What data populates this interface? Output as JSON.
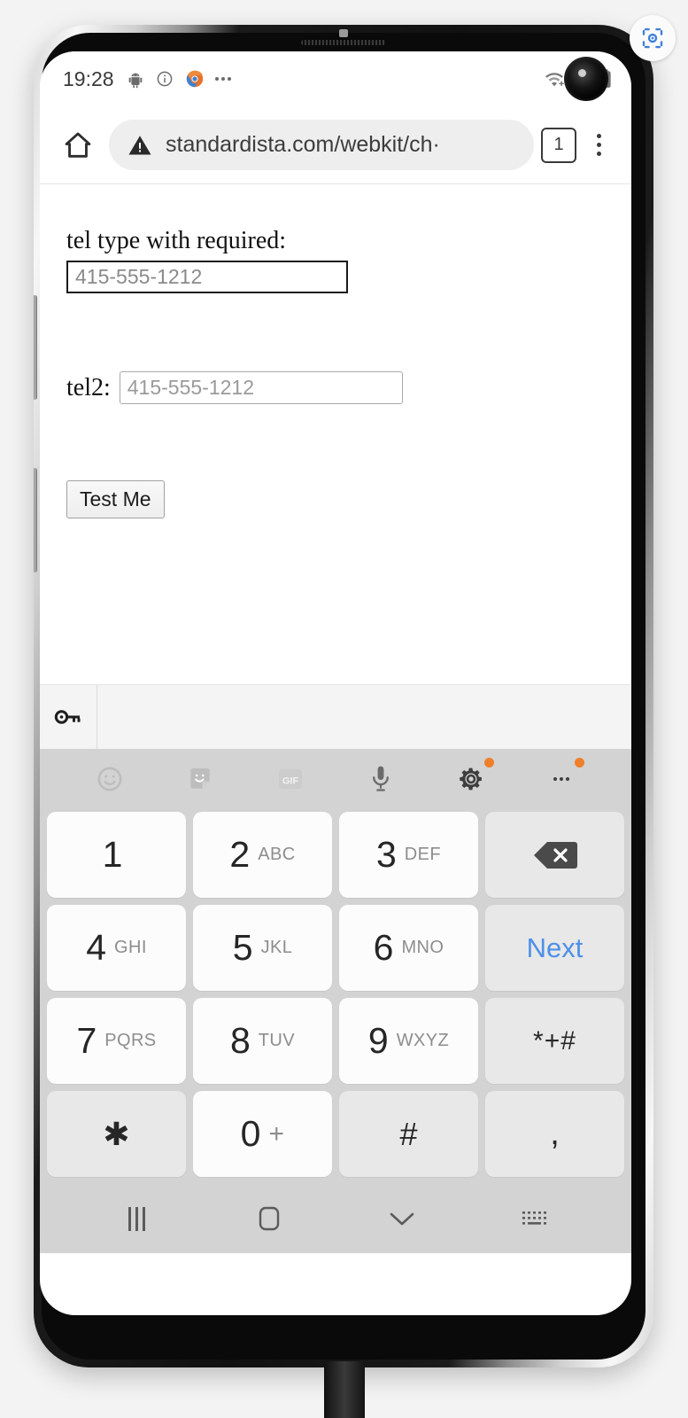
{
  "capture": {
    "icon": "screenshot-scan-icon",
    "accent": "#3f7fdb"
  },
  "statusbar": {
    "time": "19:28",
    "left_icons": [
      "android-robot-icon",
      "info-circle-icon",
      "chrome-icon",
      "more-notifications-icon"
    ],
    "right_icons": [
      "wifi-plus-icon",
      "cellular-signal-icon",
      "battery-icon"
    ]
  },
  "browser": {
    "home_icon": "home-icon",
    "security_icon": "not-secure-warning-icon",
    "url": "standardista.com/webkit/ch·",
    "tab_count": "1",
    "menu_icon": "overflow-menu-icon"
  },
  "page": {
    "tel1_label": "tel type with required:",
    "tel1_value": "415-555-1212",
    "tel1_placeholder": "415-555-1212",
    "tel2_label": "tel2:",
    "tel2_value": "415-555-1212",
    "tel2_placeholder": "415-555-1212",
    "submit_label": "Test Me"
  },
  "autofill": {
    "icon": "password-key-icon"
  },
  "keyboard": {
    "toolbar": [
      {
        "name": "emoji-icon",
        "badge": false
      },
      {
        "name": "sticker-icon",
        "badge": false
      },
      {
        "name": "gif-icon",
        "badge": false,
        "label": "GIF"
      },
      {
        "name": "microphone-icon",
        "badge": false
      },
      {
        "name": "settings-gear-icon",
        "badge": true
      },
      {
        "name": "more-options-icon",
        "badge": true
      }
    ],
    "keys": [
      {
        "num": "1",
        "sub": "",
        "type": "digit"
      },
      {
        "num": "2",
        "sub": "ABC",
        "type": "digit"
      },
      {
        "num": "3",
        "sub": "DEF",
        "type": "digit"
      },
      {
        "num": "",
        "sub": "",
        "type": "backspace"
      },
      {
        "num": "4",
        "sub": "GHI",
        "type": "digit"
      },
      {
        "num": "5",
        "sub": "JKL",
        "type": "digit"
      },
      {
        "num": "6",
        "sub": "MNO",
        "type": "digit"
      },
      {
        "num": "Next",
        "sub": "",
        "type": "next"
      },
      {
        "num": "7",
        "sub": "PQRS",
        "type": "digit"
      },
      {
        "num": "8",
        "sub": "TUV",
        "type": "digit"
      },
      {
        "num": "9",
        "sub": "WXYZ",
        "type": "digit"
      },
      {
        "num": "*+#",
        "sub": "",
        "type": "starhash"
      },
      {
        "num": "✱",
        "sub": "",
        "type": "symbol"
      },
      {
        "num": "0",
        "sub": "+",
        "type": "digit"
      },
      {
        "num": "#",
        "sub": "",
        "type": "symbol"
      },
      {
        "num": ",",
        "sub": "",
        "type": "comma"
      }
    ],
    "next_color": "#4d90e8",
    "badge_color": "#f07f2a"
  },
  "navbar": {
    "items": [
      "recents-icon",
      "home-icon",
      "collapse-keyboard-icon",
      "keyboard-switch-icon"
    ]
  }
}
